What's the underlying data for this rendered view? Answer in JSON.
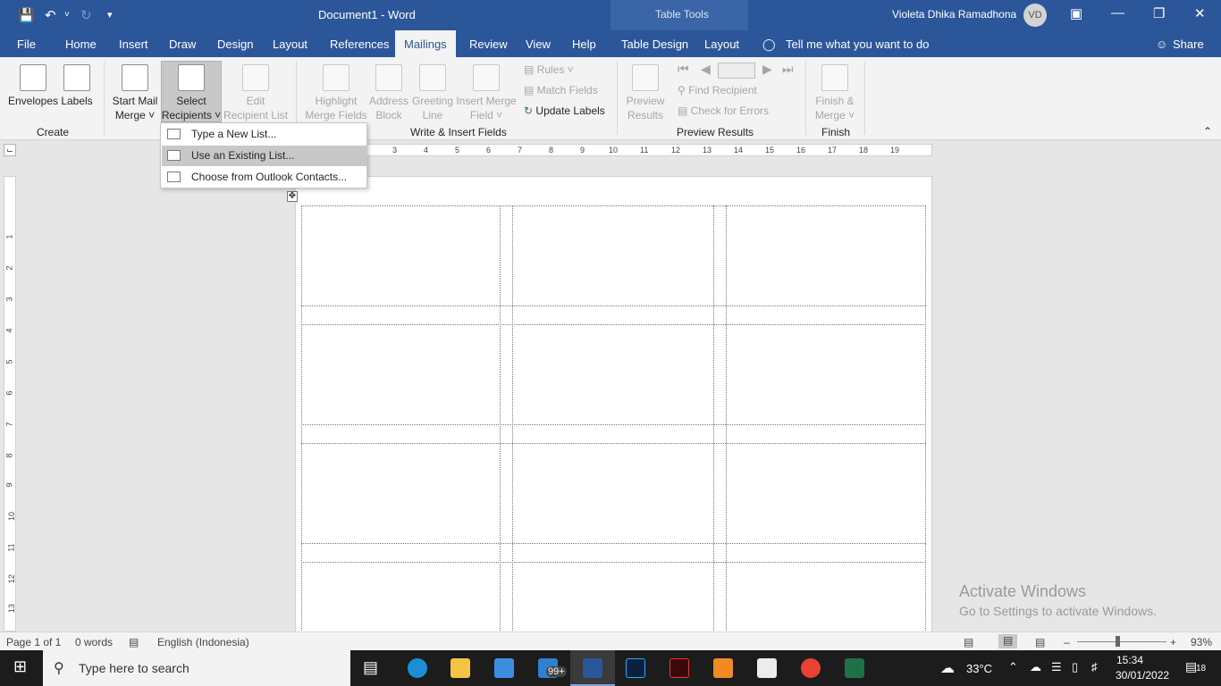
{
  "titlebar": {
    "title": "Document1  -  Word",
    "table_tools": "Table Tools",
    "user": "Violeta Dhika Ramadhona",
    "initials": "VD"
  },
  "tabs": [
    "File",
    "Home",
    "Insert",
    "Draw",
    "Design",
    "Layout",
    "References",
    "Mailings",
    "Review",
    "View",
    "Help",
    "Table Design",
    "Layout"
  ],
  "tell_me": "Tell me what you want to do",
  "share": "Share",
  "ribbon": {
    "envelopes": "Envelopes",
    "labels": "Labels",
    "start_mail_1": "Start Mail",
    "start_mail_2": "Merge ˅",
    "select_1": "Select",
    "select_2": "Recipients ˅",
    "edit_1": "Edit",
    "edit_2": "Recipient List",
    "highlight_1": "Highlight",
    "highlight_2": "Merge Fields",
    "address_1": "Address",
    "address_2": "Block",
    "greeting_1": "Greeting",
    "greeting_2": "Line",
    "insert_1": "Insert Merge",
    "insert_2": "Field ˅",
    "rules": "Rules ˅",
    "match": "Match Fields",
    "update": "Update Labels",
    "preview_1": "Preview",
    "preview_2": "Results",
    "find": "Find Recipient",
    "check": "Check for Errors",
    "finish_1": "Finish &",
    "finish_2": "Merge ˅",
    "groups": {
      "create": "Create",
      "write": "Write & Insert Fields",
      "preview": "Preview Results",
      "finish": "Finish"
    }
  },
  "menu": [
    "Type a New List...",
    "Use an Existing List...",
    "Choose from Outlook Contacts..."
  ],
  "ruler": [
    "3",
    "4",
    "5",
    "6",
    "7",
    "8",
    "9",
    "10",
    "11",
    "12",
    "13",
    "14",
    "15",
    "16",
    "17",
    "18",
    "19"
  ],
  "vruler": [
    "1",
    "2",
    "3",
    "4",
    "5",
    "6",
    "7",
    "8",
    "9",
    "10",
    "11",
    "12",
    "13"
  ],
  "status": {
    "page": "Page 1 of 1",
    "words": "0 words",
    "language": "English (Indonesia)",
    "zoom": "93%"
  },
  "watermark": {
    "line1": "Activate Windows",
    "line2": "Go to Settings to activate Windows."
  },
  "taskbar": {
    "search": "Type here to search",
    "temp": "33°C",
    "time": "15:34",
    "date": "30/01/2022",
    "mail_badge": "99+",
    "notif": "18"
  }
}
